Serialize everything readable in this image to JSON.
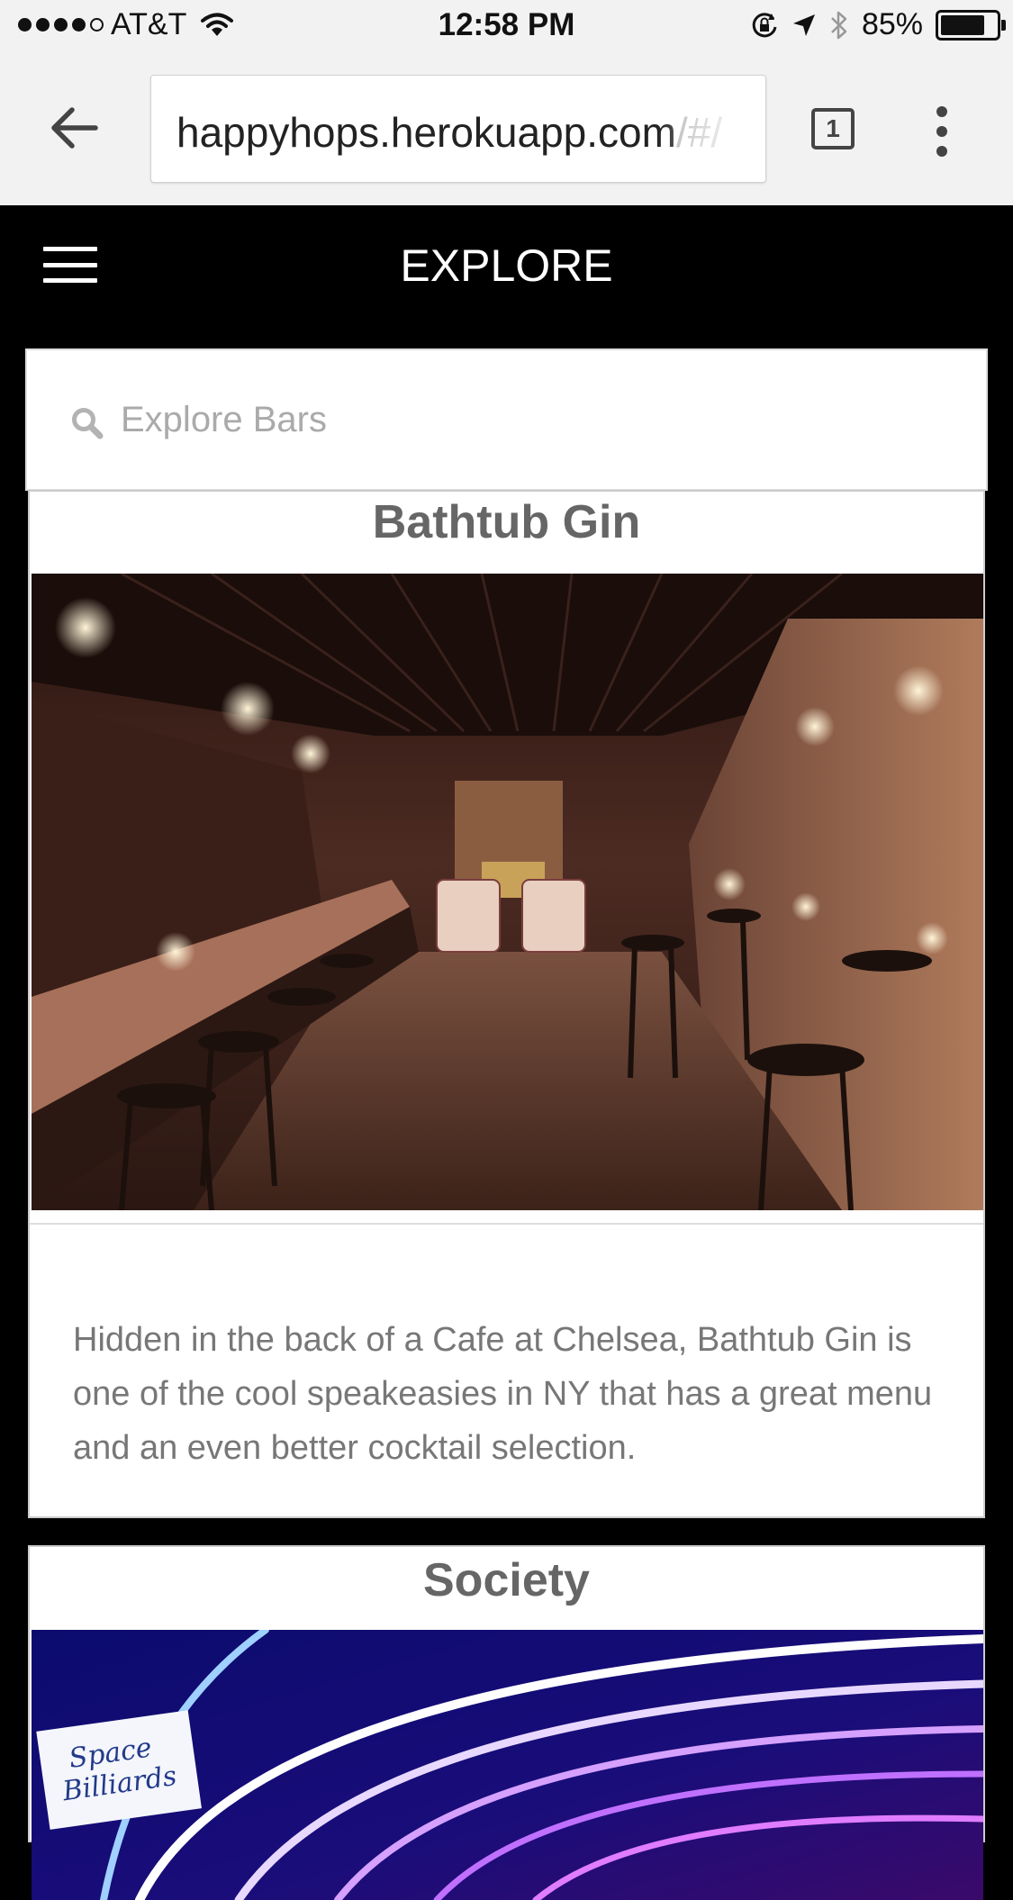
{
  "status_bar": {
    "carrier": "AT&T",
    "time": "12:58 PM",
    "battery": "85%",
    "battery_level": 0.85,
    "icons": [
      "signal-dots-icon",
      "wifi-icon",
      "orientation-lock-icon",
      "location-arrow-icon",
      "bluetooth-icon",
      "battery-icon"
    ]
  },
  "browser": {
    "url_host": "happyhops.herokuapp.com",
    "url_path": "/#/",
    "tab_count": "1",
    "icons": [
      "back-arrow-icon",
      "tab-switcher-icon",
      "overflow-menu-icon"
    ]
  },
  "header": {
    "title": "EXPLORE",
    "icons": [
      "hamburger-menu-icon"
    ]
  },
  "search": {
    "placeholder": "Explore Bars",
    "icon": "search-icon"
  },
  "bars": [
    {
      "name": "Bathtub Gin",
      "description": "Hidden in the back of a Cafe at Chelsea, Bathtub Gin is one of the cool speakeasies in NY that has a great menu and an even better cocktail selection.",
      "photo": "speakeasy-bar-interior"
    },
    {
      "name": "Society",
      "photo": "neon-lounge-interior",
      "photo_sign": [
        "Space",
        "Billiards"
      ]
    }
  ],
  "colors": {
    "page_bg": "#000000",
    "chrome_bg": "#f2f2f2",
    "card_bg": "#ffffff",
    "title_text": "#666666",
    "body_text": "#777777"
  }
}
